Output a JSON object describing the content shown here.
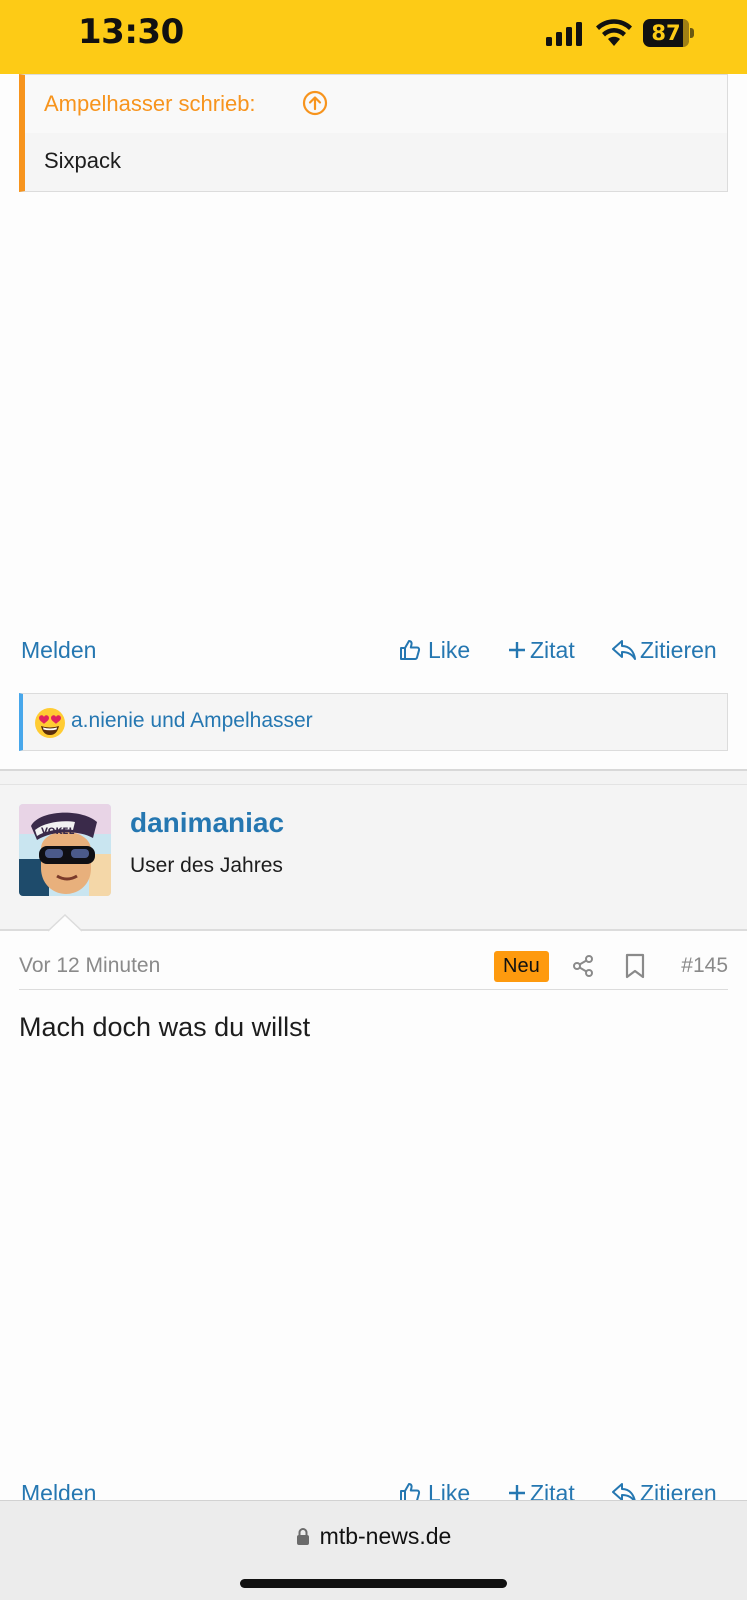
{
  "status_bar": {
    "time": "13:30",
    "battery": "87",
    "battery_level": 0.87
  },
  "quote": {
    "author_line": "Ampelhasser schrieb:",
    "text": "Sixpack"
  },
  "actions": {
    "report": "Melden",
    "like": "Like",
    "quote_plus": "Zitat",
    "reply": "Zitieren"
  },
  "reactions": {
    "emoji": "heart-eyes",
    "users": "a.nienie und Ampelhasser"
  },
  "post": {
    "username": "danimaniac",
    "user_title": "User des Jahres",
    "time": "Vor 12 Minuten",
    "badge": "Neu",
    "number": "#145",
    "body": "Mach doch was du willst"
  },
  "browser": {
    "url": "mtb-news.de"
  },
  "colors": {
    "status_bar": "#fdcb16",
    "link": "#2577b1",
    "quote_accent": "#f7941d",
    "badge": "#fe9a0e"
  }
}
